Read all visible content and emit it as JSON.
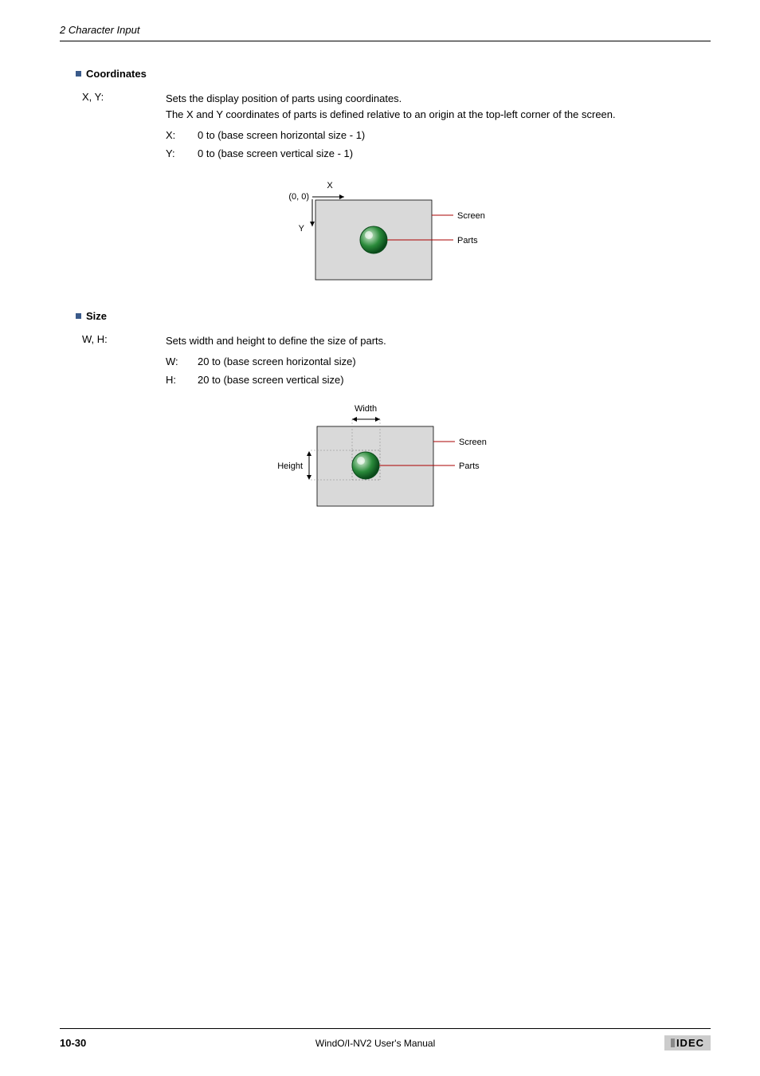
{
  "header": "2 Character Input",
  "sections": {
    "coordinates": {
      "heading": "Coordinates",
      "term": "X, Y:",
      "desc1": "Sets the display position of parts using coordinates.",
      "desc2": "The X and Y coordinates of parts is defined relative to an origin at the top-left corner of the screen.",
      "sub": [
        {
          "term": "X:",
          "desc": "0 to (base screen horizontal size - 1)"
        },
        {
          "term": "Y:",
          "desc": "0 to (base screen vertical size - 1)"
        }
      ],
      "diagram": {
        "origin": "(0, 0)",
        "xlabel": "X",
        "ylabel": "Y",
        "screen": "Screen",
        "parts": "Parts"
      }
    },
    "size": {
      "heading": "Size",
      "term": "W, H:",
      "desc1": "Sets width and height to define the size of parts.",
      "sub": [
        {
          "term": "W:",
          "desc": "20 to (base screen horizontal size)"
        },
        {
          "term": "H:",
          "desc": "20 to (base screen vertical size)"
        }
      ],
      "diagram": {
        "width": "Width",
        "height": "Height",
        "screen": "Screen",
        "parts": "Parts"
      }
    }
  },
  "footer": {
    "page": "10-30",
    "title": "WindO/I-NV2 User's Manual",
    "logo": "IDEC"
  }
}
